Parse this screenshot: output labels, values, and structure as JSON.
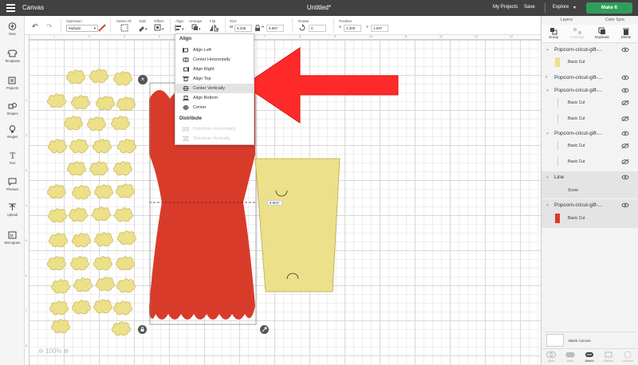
{
  "header": {
    "app_name": "Canvas",
    "document_title": "Untitled*",
    "my_projects": "My Projects",
    "save": "Save",
    "explore": "Explore",
    "make_it": "Make It"
  },
  "toolbar": {
    "operation_label": "Operation",
    "operation_value": "Multiple",
    "select_all_label": "Select All",
    "edit_label": "Edit",
    "offset_label": "Offset",
    "align_label": "Align",
    "arrange_label": "Arrange",
    "flip_label": "Flip",
    "size_label": "Size",
    "width_prefix": "W",
    "width_value": "8.335",
    "height_prefix": "H",
    "height_value": "8.987",
    "rotate_label": "Rotate",
    "rotate_value": "0",
    "position_label": "Position",
    "x_prefix": "X",
    "x_value": "4.309",
    "y_prefix": "Y",
    "y_value": "1.597"
  },
  "sidebar": {
    "items": [
      {
        "label": "New",
        "icon": "plus-circle-icon"
      },
      {
        "label": "Templates",
        "icon": "shirt-icon"
      },
      {
        "label": "Projects",
        "icon": "projects-icon"
      },
      {
        "label": "Shapes",
        "icon": "shapes-icon"
      },
      {
        "label": "Images",
        "icon": "lightbulb-icon"
      },
      {
        "label": "Text",
        "icon": "text-icon"
      },
      {
        "label": "Phrases",
        "icon": "speech-bubble-icon"
      },
      {
        "label": "Upload",
        "icon": "upload-icon"
      },
      {
        "label": "Monogram",
        "icon": "monogram-icon"
      }
    ]
  },
  "ruler": {
    "top": [
      "1",
      "2",
      "3",
      "4",
      "5",
      "6",
      "7",
      "8",
      "9",
      "10",
      "11",
      "12",
      "13",
      "14"
    ],
    "left": [
      "1",
      "2",
      "3",
      "4",
      "5",
      "6",
      "7",
      "8"
    ]
  },
  "align_menu": {
    "align_header": "Align",
    "items": [
      {
        "label": "Align Left",
        "active": false
      },
      {
        "label": "Center Horizontally",
        "active": false
      },
      {
        "label": "Align Right",
        "active": false
      },
      {
        "label": "Align Top",
        "active": false
      },
      {
        "label": "Center Vertically",
        "active": true
      },
      {
        "label": "Align Bottom",
        "active": false
      },
      {
        "label": "Center",
        "active": false
      }
    ],
    "distribute_header": "Distribute",
    "distribute_items": [
      "Distribute Horizontally",
      "Distribute Vertically"
    ]
  },
  "canvas": {
    "dimension_label": "8.901\"",
    "zoom_value": "100%"
  },
  "right_panel": {
    "tabs": [
      "Layers",
      "Color Sync"
    ],
    "actions": [
      {
        "label": "Group",
        "enabled": true
      },
      {
        "label": "UnGroup",
        "enabled": false
      },
      {
        "label": "Duplicate",
        "enabled": true
      },
      {
        "label": "Delete",
        "enabled": true
      }
    ],
    "layers": [
      {
        "name": "Popcorn-cricut-gift-...",
        "children": [
          {
            "label": "Basic Cut",
            "color": "#ede08a"
          }
        ]
      },
      {
        "name": "Popcorn-cricut-gift-...",
        "children": []
      },
      {
        "name": "Popcorn-cricut-gift-...",
        "children": [
          {
            "label": "Basic Cut",
            "color": ""
          },
          {
            "label": "Basic Cut",
            "color": ""
          }
        ]
      },
      {
        "name": "Popcorn-cricut-gift-...",
        "children": [
          {
            "label": "Basic Cut",
            "color": ""
          },
          {
            "label": "Basic Cut",
            "color": ""
          }
        ]
      },
      {
        "name": "Line",
        "children": [
          {
            "label": "Score",
            "color": ""
          }
        ]
      },
      {
        "name": "Popcorn-cricut-gift-...",
        "children": [
          {
            "label": "Basic Cut",
            "color": "#d93b2b"
          }
        ]
      }
    ],
    "blank_canvas": "Blank Canvas",
    "bottom_tools": [
      {
        "label": "Slice",
        "enabled": false
      },
      {
        "label": "Weld",
        "enabled": false
      },
      {
        "label": "Attach",
        "enabled": true
      },
      {
        "label": "Flatten",
        "enabled": false
      },
      {
        "label": "Contour",
        "enabled": false
      }
    ]
  },
  "colors": {
    "popcorn": "#ede08a",
    "box_red": "#d93b2b",
    "arrow_red": "#ff2a2a",
    "make_it_green": "#2f9e59",
    "topbar": "#414141"
  }
}
